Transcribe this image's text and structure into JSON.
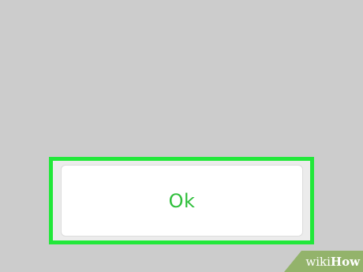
{
  "dialog": {
    "ok_label": "Ok"
  },
  "watermark": {
    "prefix": "wiki",
    "suffix": "How"
  },
  "colors": {
    "background": "#cccccc",
    "highlight": "#22e83a",
    "button_text": "#2fbf3b",
    "watermark_bg": "#93b36b"
  }
}
